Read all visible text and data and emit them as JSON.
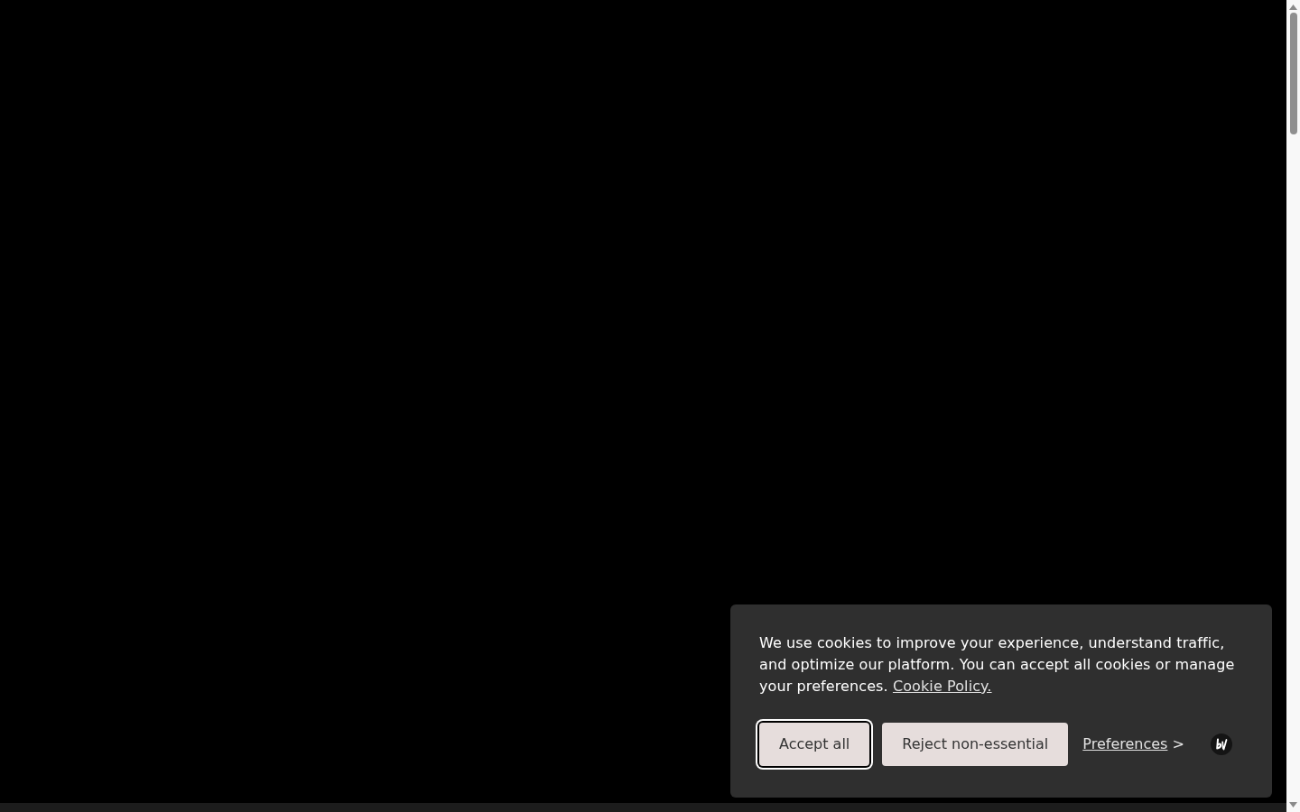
{
  "cookie_banner": {
    "message": "We use cookies to improve your experience, understand traffic, and optimize our platform. You can accept all cookies or manage your preferences.",
    "policy_link": "Cookie Policy.",
    "buttons": [
      {
        "label": "Accept all",
        "focused": true
      },
      {
        "label": "Reject non-essential",
        "focused": false
      }
    ],
    "preferences_link": {
      "label": "Preferences",
      "arrow": ">"
    }
  }
}
